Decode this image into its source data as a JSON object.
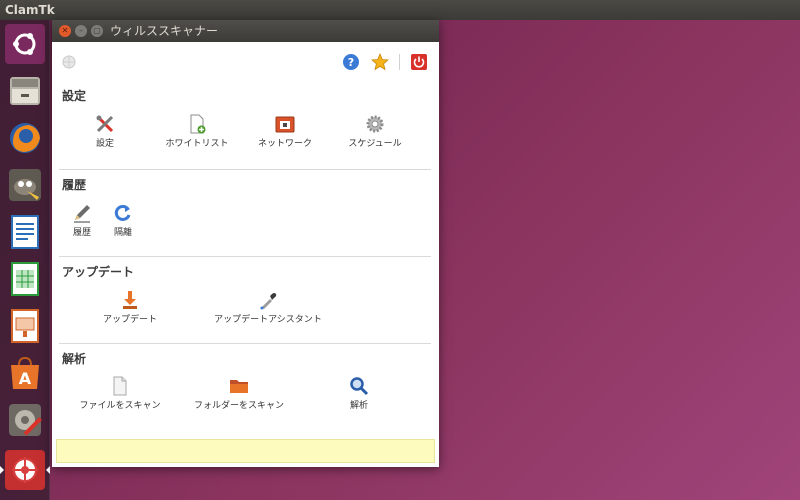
{
  "top_panel": {
    "app_name": "ClamTk"
  },
  "launcher": {
    "items": [
      {
        "name": "ubuntu-dash",
        "icon": "ubuntu-logo-icon"
      },
      {
        "name": "files",
        "icon": "file-cabinet-icon"
      },
      {
        "name": "firefox",
        "icon": "firefox-icon"
      },
      {
        "name": "gimp",
        "icon": "gimp-icon"
      },
      {
        "name": "writer",
        "icon": "libreoffice-writer-icon"
      },
      {
        "name": "calc",
        "icon": "libreoffice-calc-icon"
      },
      {
        "name": "impress",
        "icon": "libreoffice-impress-icon"
      },
      {
        "name": "software-center",
        "icon": "software-center-icon"
      },
      {
        "name": "system-settings",
        "icon": "system-settings-icon"
      },
      {
        "name": "clamtk",
        "icon": "clamtk-icon"
      }
    ]
  },
  "window": {
    "title": "ウィルススキャナー",
    "sections": {
      "settings": {
        "title": "設定",
        "items": [
          {
            "label": "設定",
            "icon": "tools-icon"
          },
          {
            "label": "ホワイトリスト",
            "icon": "document-add-icon"
          },
          {
            "label": "ネットワーク",
            "icon": "network-icon"
          },
          {
            "label": "スケジュール",
            "icon": "gear-icon"
          }
        ]
      },
      "history": {
        "title": "履歴",
        "items": [
          {
            "label": "履歴",
            "icon": "pencil-icon"
          },
          {
            "label": "隔離",
            "icon": "refresh-icon"
          }
        ]
      },
      "update": {
        "title": "アップデート",
        "items": [
          {
            "label": "アップデート",
            "icon": "download-icon"
          },
          {
            "label": "アップデートアシスタント",
            "icon": "dropper-icon"
          }
        ]
      },
      "analysis": {
        "title": "解析",
        "items": [
          {
            "label": "ファイルをスキャン",
            "icon": "file-icon"
          },
          {
            "label": "フォルダーをスキャン",
            "icon": "folder-icon"
          },
          {
            "label": "解析",
            "icon": "magnifier-icon"
          }
        ]
      }
    }
  },
  "colors": {
    "accent_red": "#e25a2c",
    "status_yellow": "#fdfbbe",
    "help_blue": "#3b7bd6",
    "star_gold": "#f5b21b",
    "power_red": "#d8322a"
  }
}
